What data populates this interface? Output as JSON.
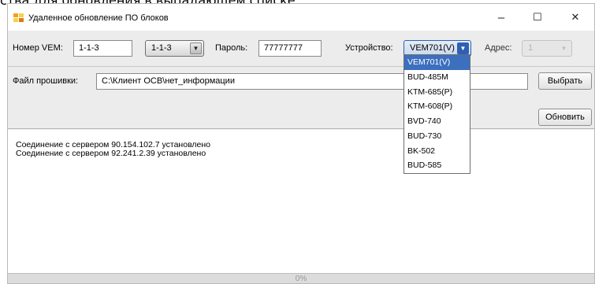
{
  "background_caption": "ства для обновления в выпадающем списке.",
  "window": {
    "title": "Удаленное обновление ПО блоков",
    "minimize_glyph": "–",
    "maximize_glyph": "☐",
    "close_glyph": "✕"
  },
  "form": {
    "vem_label": "Номер VEM:",
    "vem_value": "1-1-3",
    "vem_combo_value": "1-1-3",
    "password_label": "Пароль:",
    "password_value": "77777777",
    "device_label": "Устройство:",
    "device_value": "VEM701(V)",
    "address_label": "Адрес:",
    "address_value": "1",
    "firmware_label": "Файл прошивки:",
    "firmware_value": "C:\\Клиент ОСВ\\нет_информации",
    "choose_button": "Выбрать",
    "update_button": "Обновить"
  },
  "device_options": [
    "VEM701(V)",
    "BUD-485M",
    "KTM-685(P)",
    "KTM-608(P)",
    "BVD-740",
    "BUD-730",
    "BK-502",
    "BUD-585"
  ],
  "device_selected_index": 0,
  "log": [
    "Соединение с сервером 90.154.102.7 установлено",
    "Соединение с сервером 92.241.2.39 установлено"
  ],
  "progress": {
    "value": 0,
    "text": "0%"
  },
  "colors": {
    "accent": "#3d6fbf",
    "arrow_active": "#2e5fb3",
    "icon_orange": "#f0a020",
    "icon_yellow": "#f6d24a"
  },
  "icons": {
    "app": "blocks-icon",
    "dropdown": "chevron-down-icon"
  }
}
